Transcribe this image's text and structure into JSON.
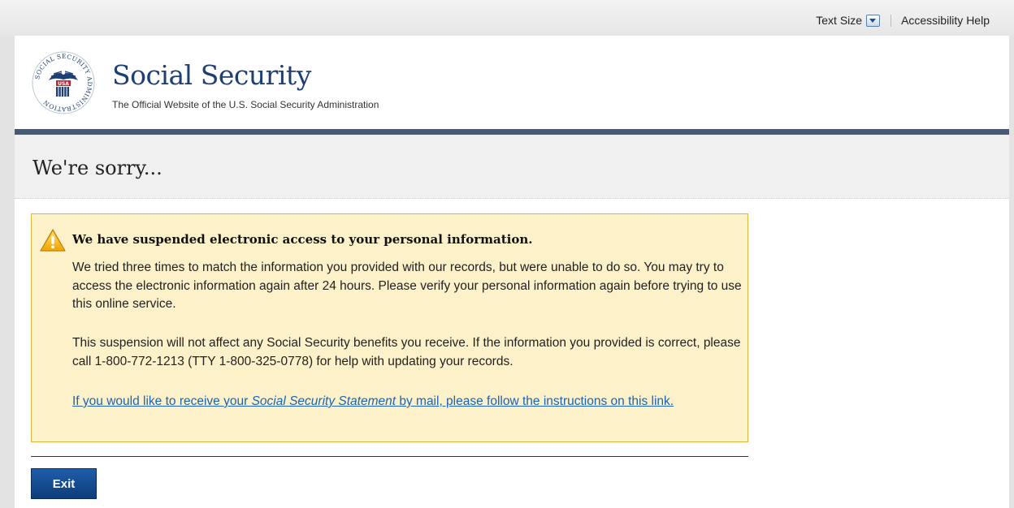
{
  "utility": {
    "text_size_label": "Text Size",
    "accessibility_label": "Accessibility Help"
  },
  "header": {
    "logo_text": "SOCIAL SECURITY ADMINISTRATION",
    "logo_usa": "USA",
    "title": "Social Security",
    "tagline": "The Official Website of the U.S. Social Security Administration"
  },
  "page_title": "We're sorry...",
  "alert": {
    "icon": "warning-icon",
    "heading": "We have suspended electronic access to your personal information.",
    "paragraph1": "We tried three times to match the information you provided with our records, but were unable to do so. You may try to access the electronic information again after 24 hours. Please verify your personal information again before trying to use this online service.",
    "paragraph2": "This suspension will not affect any Social Security benefits you receive. If the information you provided is correct, please call 1-800-772-1213 (TTY 1-800-325-0778) for help with updating your records.",
    "link_before": "If you would like to receive your ",
    "link_italic": "Social Security Statement",
    "link_after": " by mail, please follow the instructions on this link."
  },
  "exit_label": "Exit",
  "colors": {
    "brand_navy": "#1f3f73",
    "alert_bg": "#fcf1c9",
    "alert_border": "#e2b43b",
    "link": "#1b63b6",
    "button": "#0d3d7c"
  }
}
